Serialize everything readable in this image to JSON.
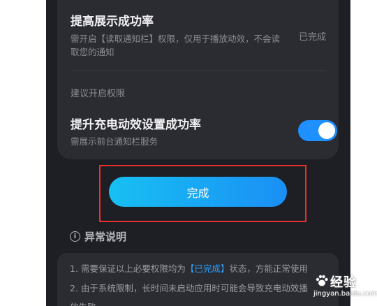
{
  "permissions": {
    "row1": {
      "title": "提高展示成功率",
      "desc": "需开启【读取通知栏】权限，仅用于播放动效，不会读取您的通知",
      "status": "已完成"
    },
    "section_label": "建议开启权限",
    "row2": {
      "title": "提升充电动效设置成功率",
      "desc": "需展示前台通知栏服务",
      "toggle_on": true
    }
  },
  "done_button": {
    "label": "完成"
  },
  "notice": {
    "header": "异常说明",
    "line1_prefix": "1. 需要保证以上必要权限均为",
    "line1_highlight": "【已完成】",
    "line1_suffix": "状态，方能正常使用",
    "line2": "2. 由于系统限制，长时间未启动应用时可能会导致充电动效播",
    "line3": "放失败"
  },
  "watermark": {
    "text": "经验",
    "url": "jingyan.baidu.com"
  },
  "colors": {
    "accent": "#1e90ff",
    "highlight_box": "#e8312c",
    "link": "#2ea2ff"
  }
}
